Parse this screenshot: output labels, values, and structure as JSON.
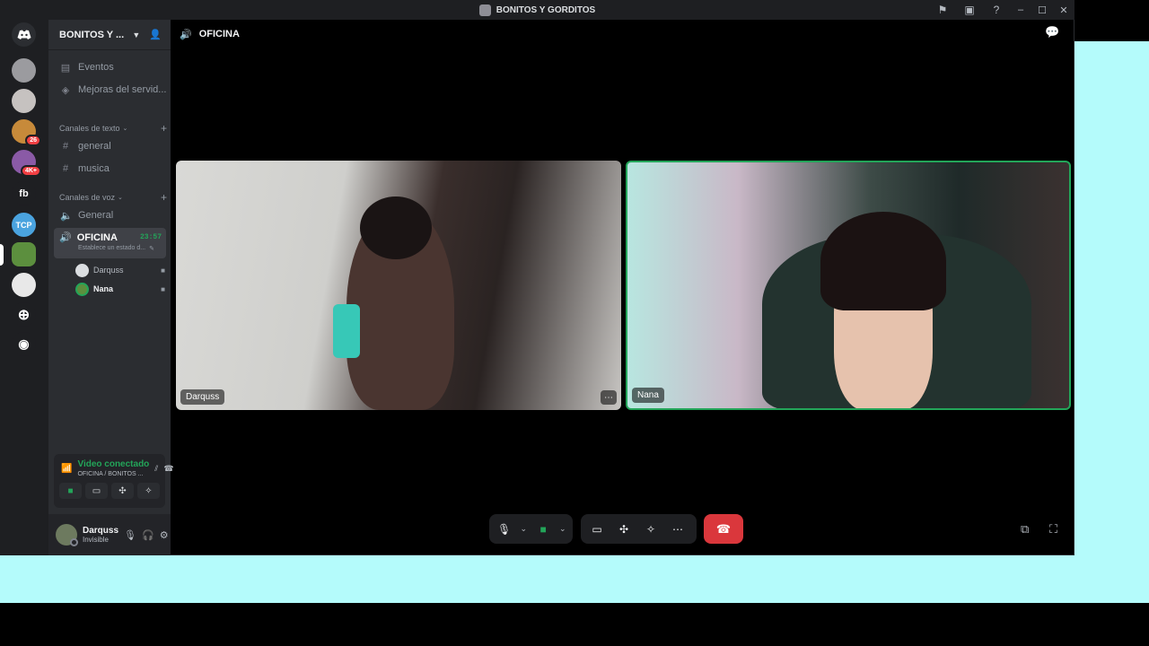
{
  "window": {
    "title": "BONITOS Y GORDITOS"
  },
  "titlebar_icons": [
    "flag-icon",
    "inbox-icon",
    "help-icon"
  ],
  "window_controls": {
    "minimize": "–",
    "maximize": "☐",
    "close": "✕"
  },
  "guild_rail": {
    "guilds": [
      {
        "name": "discord-home",
        "label": ""
      },
      {
        "name": "guild-1",
        "label": ""
      },
      {
        "name": "guild-2",
        "label": ""
      },
      {
        "name": "guild-3",
        "label": "",
        "badge": "26"
      },
      {
        "name": "guild-4",
        "label": "",
        "badge": "4K+"
      },
      {
        "name": "guild-fb",
        "label": "fb"
      },
      {
        "name": "guild-tcp",
        "label": "TCP"
      },
      {
        "name": "guild-current",
        "label": ""
      },
      {
        "name": "guild-6",
        "label": ""
      }
    ]
  },
  "server": {
    "name": "BONITOS Y ...",
    "top_items": [
      {
        "label": "Eventos",
        "icon": "calendar-icon"
      },
      {
        "label": "Mejoras del servid...",
        "icon": "boost-icon"
      }
    ],
    "text_category": "Canales de texto",
    "text_channels": [
      "general",
      "musica"
    ],
    "voice_category": "Canales de voz",
    "voice_channels": [
      "General"
    ],
    "active_voice": {
      "name": "OFICINA",
      "timer": "23:57",
      "status": "Establece un estado d..."
    },
    "voice_users": [
      {
        "name": "Darquss"
      },
      {
        "name": "Nana"
      }
    ]
  },
  "rtc": {
    "status": "Video conectado",
    "location": "OFICINA / BONITOS ..."
  },
  "user": {
    "name": "Darquss",
    "status": "Invisible"
  },
  "call": {
    "channel": "OFICINA",
    "participants": [
      {
        "name": "Darquss"
      },
      {
        "name": "Nana"
      }
    ]
  },
  "colors": {
    "accent_green": "#23a559",
    "hangup_red": "#da373c",
    "sidebar": "#2b2d31",
    "rail": "#1e1f22",
    "backdrop": "#b4fbfb"
  }
}
